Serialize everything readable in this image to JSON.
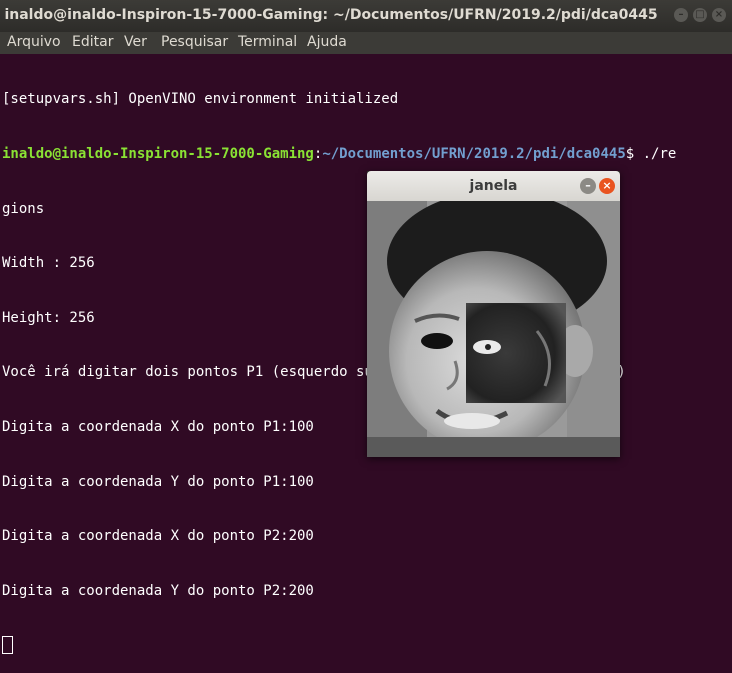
{
  "window": {
    "title": "inaldo@inaldo-Inspiron-15-7000-Gaming: ~/Documentos/UFRN/2019.2/pdi/dca0445",
    "min_glyph": "–",
    "max_glyph": "□",
    "close_glyph": "×"
  },
  "menu": [
    "Arquivo",
    "Editar",
    "Ver",
    "Pesquisar",
    "Terminal",
    "Ajuda"
  ],
  "terminal": {
    "line1": "[setupvars.sh] OpenVINO environment initialized",
    "prompt_user": "inaldo@inaldo-Inspiron-15-7000-Gaming",
    "prompt_sep": ":",
    "prompt_path": "~/Documentos/UFRN/2019.2/pdi/dca0445",
    "prompt_cmd": "$ ./re",
    "line3": "gions",
    "line4": "Width : 256",
    "line5": "Height: 256",
    "line6": "Você irá digitar dois pontos P1 (esquerdo superior) e P2(Direito inferior)",
    "line7": "Digita a coordenada X do ponto P1:100",
    "line8": "Digita a coordenada Y do ponto P1:100",
    "line9": "Digita a coordenada X do ponto P2:200",
    "line10": "Digita a coordenada Y do ponto P2:200"
  },
  "image_window": {
    "title": "janela",
    "min_glyph": "–",
    "close_glyph": "×"
  },
  "colors": {
    "terminal_bg": "#300a24",
    "prompt_user": "#8ae234",
    "prompt_path": "#729fcf",
    "close_button": "#e95420"
  }
}
